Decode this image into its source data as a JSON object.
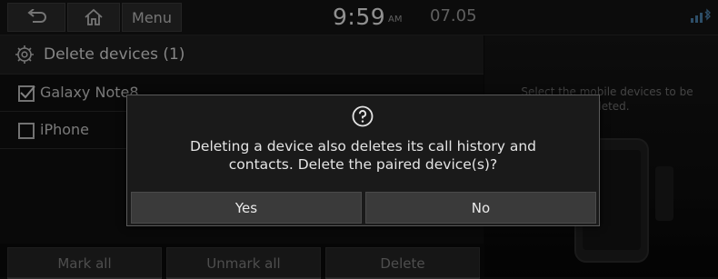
{
  "topbar": {
    "back_icon": "back-arrow-icon",
    "home_icon": "home-icon",
    "menu_label": "Menu",
    "time": "9:59",
    "ampm": "AM",
    "date": "07.05",
    "status_icon": "bluetooth-signal-icon"
  },
  "header": {
    "icon": "gear-icon",
    "title": "Delete devices (1)"
  },
  "devices": [
    {
      "label": "Galaxy Note8",
      "checked": true
    },
    {
      "label": "iPhone",
      "checked": false
    }
  ],
  "side_panel": {
    "guide_text": "Select the mobile devices to be deleted."
  },
  "bottom_buttons": {
    "mark_all": "Mark all",
    "unmark_all": "Unmark all",
    "delete": "Delete"
  },
  "dialog": {
    "icon": "question-icon",
    "message_line1": "Deleting a device also deletes its call history and",
    "message_line2": "contacts. Delete the paired device(s)?",
    "yes_label": "Yes",
    "no_label": "No"
  }
}
